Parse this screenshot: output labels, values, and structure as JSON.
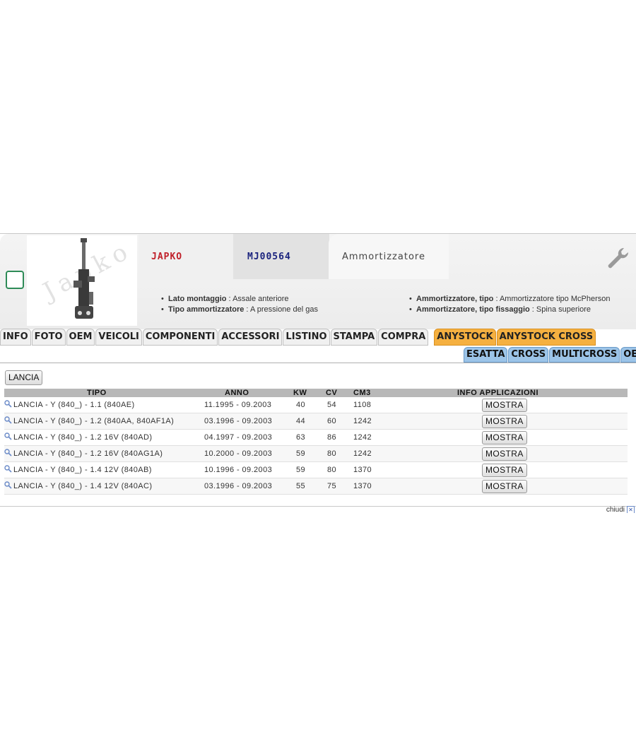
{
  "header": {
    "brand": "JAPKO",
    "code": "MJ00564",
    "description": "Ammortizzatore",
    "watermark": "Japko"
  },
  "attributes_left": [
    {
      "name": "Lato montaggio",
      "value": "Assale anteriore"
    },
    {
      "name": "Tipo ammortizzatore",
      "value": "A pressione del gas"
    }
  ],
  "attributes_right": [
    {
      "name": "Ammortizzatore, tipo",
      "value": "Ammortizzatore tipo McPherson"
    },
    {
      "name": "Ammortizzatore, tipo fissaggio",
      "value": "Spina superiore"
    }
  ],
  "tabs": [
    "INFO",
    "FOTO",
    "OEM",
    "VEICOLI",
    "COMPONENTI",
    "ACCESSORI",
    "LISTINO",
    "STAMPA",
    "COMPRA"
  ],
  "tabs_orange": [
    "ANYSTOCK",
    "ANYSTOCK CROSS"
  ],
  "subtabs": [
    "ESATTA",
    "CROSS",
    "MULTICROSS",
    "OE"
  ],
  "make_button": "LANCIA",
  "table": {
    "columns": {
      "tipo": "TIPO",
      "anno": "ANNO",
      "kw": "KW",
      "cv": "CV",
      "cm3": "CM3",
      "info": "INFO APPLICAZIONI"
    },
    "rows": [
      {
        "tipo": "LANCIA - Y (840_) - 1.1 (840AE)",
        "anno": "11.1995 - 09.2003",
        "kw": "40",
        "cv": "54",
        "cm3": "1108",
        "action": "MOSTRA"
      },
      {
        "tipo": "LANCIA - Y (840_) - 1.2 (840AA, 840AF1A)",
        "anno": "03.1996 - 09.2003",
        "kw": "44",
        "cv": "60",
        "cm3": "1242",
        "action": "MOSTRA"
      },
      {
        "tipo": "LANCIA - Y (840_) - 1.2 16V (840AD)",
        "anno": "04.1997 - 09.2003",
        "kw": "63",
        "cv": "86",
        "cm3": "1242",
        "action": "MOSTRA"
      },
      {
        "tipo": "LANCIA - Y (840_) - 1.2 16V (840AG1A)",
        "anno": "10.2000 - 09.2003",
        "kw": "59",
        "cv": "80",
        "cm3": "1242",
        "action": "MOSTRA"
      },
      {
        "tipo": "LANCIA - Y (840_) - 1.4 12V (840AB)",
        "anno": "10.1996 - 09.2003",
        "kw": "59",
        "cv": "80",
        "cm3": "1370",
        "action": "MOSTRA"
      },
      {
        "tipo": "LANCIA - Y (840_) - 1.4 12V (840AC)",
        "anno": "03.1996 - 09.2003",
        "kw": "55",
        "cv": "75",
        "cm3": "1370",
        "action": "MOSTRA"
      }
    ]
  },
  "close_label": "chiudi",
  "colors": {
    "brand": "#c0202a",
    "code": "#1a237e",
    "orange_tab": "#f5b040",
    "blue_tab": "#9cc4e8",
    "check": "#2e8b57"
  }
}
